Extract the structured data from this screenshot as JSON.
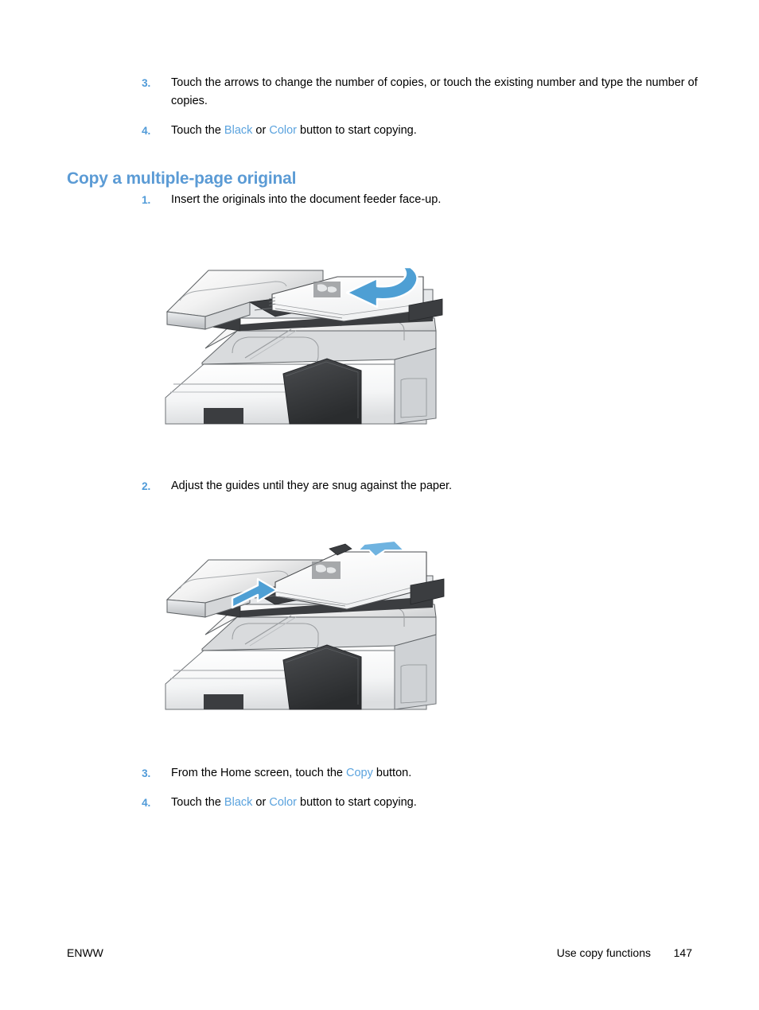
{
  "document": {
    "heading": "Copy a multiple-page original",
    "heading_color": "#5b9bd5",
    "link_color": "#5ba3de",
    "number_color": "#4f9ad8"
  },
  "intro_steps": [
    {
      "number": "3.",
      "segments": [
        {
          "text": "Touch the arrows to change the number of copies, or touch the existing number and type the number of copies.",
          "style": "plain"
        }
      ]
    },
    {
      "number": "4.",
      "segments": [
        {
          "text": "Touch the ",
          "style": "plain"
        },
        {
          "text": "Black",
          "style": "link"
        },
        {
          "text": " or ",
          "style": "plain"
        },
        {
          "text": "Color",
          "style": "link"
        },
        {
          "text": " button to start copying.",
          "style": "plain"
        }
      ]
    }
  ],
  "step_1": {
    "number": "1.",
    "text": "Insert the originals into the document feeder face-up."
  },
  "step_2": {
    "number": "2.",
    "text": "Adjust the guides until they are snug against the paper."
  },
  "final_steps": [
    {
      "number": "3.",
      "segments": [
        {
          "text": "From the Home screen, touch the ",
          "style": "plain"
        },
        {
          "text": "Copy",
          "style": "link"
        },
        {
          "text": " button.",
          "style": "plain"
        }
      ]
    },
    {
      "number": "4.",
      "segments": [
        {
          "text": "Touch the ",
          "style": "plain"
        },
        {
          "text": "Black",
          "style": "link"
        },
        {
          "text": " or ",
          "style": "plain"
        },
        {
          "text": "Color",
          "style": "link"
        },
        {
          "text": " button to start copying.",
          "style": "plain"
        }
      ]
    }
  ],
  "figures": [
    {
      "name": "printer-document-feeder-load",
      "caption_ref": "step_1",
      "description": "Multifunction printer with paper stack loaded face-up in document feeder, blue curved arrow indicating insertion direction",
      "arrow_color": "#4e9fd4"
    },
    {
      "name": "printer-document-feeder-guides",
      "caption_ref": "step_2",
      "description": "Multifunction printer with two blue arrows showing paper guides being adjusted snug against the paper",
      "arrow_color": "#4e9fd4"
    }
  ],
  "footer": {
    "left": "ENWW",
    "chapter": "Use copy functions",
    "page_number": "147"
  }
}
